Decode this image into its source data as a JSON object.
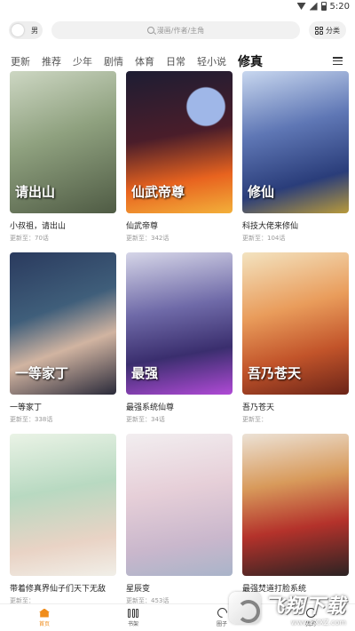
{
  "status_bar": {
    "time": "5:20"
  },
  "header": {
    "gender_label": "男",
    "search_placeholder": "漫画/作者/主角",
    "category_label": "分类"
  },
  "tabs": [
    {
      "label": "更新"
    },
    {
      "label": "推荐"
    },
    {
      "label": "少年"
    },
    {
      "label": "剧情"
    },
    {
      "label": "体育"
    },
    {
      "label": "日常"
    },
    {
      "label": "轻小说"
    },
    {
      "label": "修真",
      "active": true
    }
  ],
  "comics": [
    {
      "title": "小叔祖，请出山",
      "update": "更新至：70话",
      "cover_text": "请出山"
    },
    {
      "title": "仙武帝尊",
      "update": "更新至：342话",
      "cover_text": "仙武帝尊"
    },
    {
      "title": "科技大佬来修仙",
      "update": "更新至：104话",
      "cover_text": "修仙"
    },
    {
      "title": "一等家丁",
      "update": "更新至：338话",
      "cover_text": "一等家丁"
    },
    {
      "title": "最强系统仙尊",
      "update": "更新至：34话",
      "cover_text": "最强"
    },
    {
      "title": "吾乃苍天",
      "update": "更新至：",
      "cover_text": "吾乃苍天"
    },
    {
      "title": "带着修真界仙子们天下无敌",
      "update": "更新至：",
      "cover_text": ""
    },
    {
      "title": "星辰变",
      "update": "更新至：453话",
      "cover_text": ""
    },
    {
      "title": "最强焚道打脸系统",
      "update": "",
      "cover_text": ""
    }
  ],
  "bottom_nav": [
    {
      "label": "首页",
      "icon": "home-icon",
      "active": true
    },
    {
      "label": "书架",
      "icon": "bookshelf-icon"
    },
    {
      "label": "圈子",
      "icon": "circle-icon"
    },
    {
      "label": "我的",
      "icon": "user-icon"
    }
  ],
  "watermark": {
    "main": "飞翔下载",
    "sub": "www.FXXZ.com"
  },
  "colors": {
    "accent": "#f08c1a",
    "text": "#222222",
    "subtext": "#999999"
  }
}
